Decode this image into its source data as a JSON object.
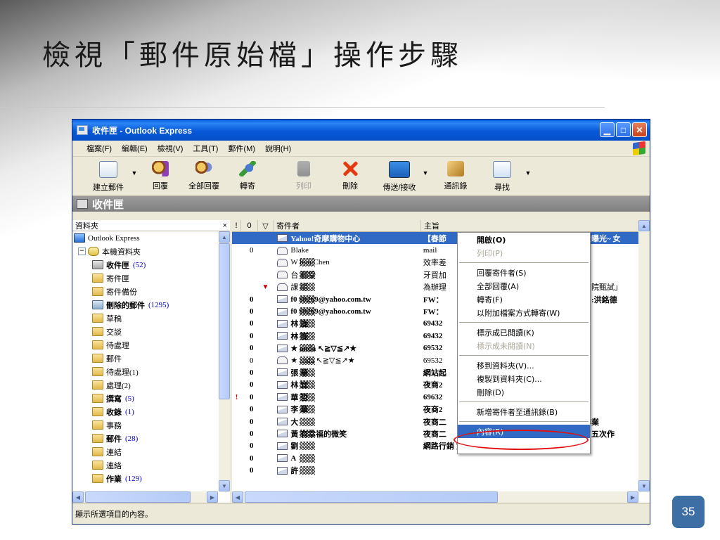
{
  "slide": {
    "title": "檢視「郵件原始檔」操作步驟",
    "page_number": "35"
  },
  "window": {
    "title": "收件匣 - Outlook Express",
    "menu": [
      "檔案(F)",
      "編輯(E)",
      "檢視(V)",
      "工具(T)",
      "郵件(M)",
      "說明(H)"
    ],
    "toolbar": [
      {
        "label": "建立郵件",
        "icon": "new-mail-icon",
        "enabled": true
      },
      {
        "label": "回覆",
        "icon": "reply-icon",
        "enabled": true
      },
      {
        "label": "全部回覆",
        "icon": "reply-all-icon",
        "enabled": true
      },
      {
        "label": "轉寄",
        "icon": "forward-icon",
        "enabled": true
      },
      {
        "label": "列印",
        "icon": "print-icon",
        "enabled": false
      },
      {
        "label": "刪除",
        "icon": "delete-icon",
        "enabled": true
      },
      {
        "label": "傳送/接收",
        "icon": "send-receive-icon",
        "enabled": true
      },
      {
        "label": "通訊錄",
        "icon": "address-book-icon",
        "enabled": true
      },
      {
        "label": "尋找",
        "icon": "find-icon",
        "enabled": true
      }
    ],
    "folder_bar_title": "收件匣",
    "folders_pane": {
      "header": "資料夾",
      "close_glyph": "×",
      "items": [
        {
          "label": "Outlook Express",
          "count": "",
          "bold": false
        },
        {
          "label": "本機資料夾",
          "count": "",
          "bold": false
        },
        {
          "label": "收件匣",
          "count": "(52)",
          "bold": true
        },
        {
          "label": "寄件匣",
          "count": "",
          "bold": false
        },
        {
          "label": "寄件備份",
          "count": "",
          "bold": false
        },
        {
          "label": "刪除的郵件",
          "count": "(1295)",
          "bold": true
        },
        {
          "label": "草稿",
          "count": "",
          "bold": false
        },
        {
          "label": "交談",
          "count": "",
          "bold": false
        },
        {
          "label": "待處理",
          "count": "",
          "bold": false
        },
        {
          "label": "郵件",
          "count": "",
          "bold": false
        },
        {
          "label": "待處理(1)",
          "count": "",
          "bold": false
        },
        {
          "label": "處理(2)",
          "count": "",
          "bold": false
        },
        {
          "label": "撰寫",
          "count": "(5)",
          "bold": true
        },
        {
          "label": "收錄",
          "count": "(1)",
          "bold": true
        },
        {
          "label": "事務",
          "count": "",
          "bold": false
        },
        {
          "label": "郵件",
          "count": "(28)",
          "bold": true
        },
        {
          "label": "連結",
          "count": "",
          "bold": false
        },
        {
          "label": "連絡",
          "count": "",
          "bold": false
        },
        {
          "label": "作業",
          "count": "(129)",
          "bold": true
        }
      ]
    },
    "message_list": {
      "columns": [
        "!",
        "0",
        "▽",
        "寄件者",
        "主旨"
      ],
      "rows": [
        {
          "from": "Yahoo!奇摩購物中心",
          "subject": "【春節",
          "subject_tail": "大曝光~ 女",
          "selected": true,
          "unread": true,
          "att": "",
          "pri": "",
          "flag": "",
          "env": "unread"
        },
        {
          "from": "Blake",
          "subject": "mail",
          "subject_tail": "",
          "selected": false,
          "unread": false,
          "att": "0",
          "pri": "",
          "flag": "",
          "env": "read"
        },
        {
          "from": "W   hou Chen",
          "subject": "效率差",
          "subject_tail": "",
          "selected": false,
          "unread": false,
          "att": "",
          "pri": "",
          "flag": "",
          "env": "read"
        },
        {
          "from": "台   郵受",
          "subject": "牙買加",
          "subject_tail": "",
          "selected": false,
          "unread": false,
          "att": "",
          "pri": "",
          "flag": "",
          "env": "read"
        },
        {
          "from": "課   組",
          "subject": "為辦理",
          "subject_tail": "校院甄試」",
          "selected": false,
          "unread": false,
          "att": "",
          "pri": "",
          "flag": "▼",
          "env": "read"
        },
        {
          "from": "f0   90269@yahoo.com.tw",
          "subject": "FW：",
          "subject_tail": "名:洪銘德",
          "selected": false,
          "unread": true,
          "att": "0",
          "pri": "",
          "flag": "",
          "env": "unread"
        },
        {
          "from": "f0   90269@yahoo.com.tw",
          "subject": "FW：",
          "subject_tail": "",
          "selected": false,
          "unread": true,
          "att": "0",
          "pri": "",
          "flag": "",
          "env": "unread"
        },
        {
          "from": "林   旋",
          "subject": "69432",
          "subject_tail": "",
          "selected": false,
          "unread": true,
          "att": "0",
          "pri": "",
          "flag": "",
          "env": "unread"
        },
        {
          "from": "林   旋",
          "subject": "69432",
          "subject_tail": "1",
          "selected": false,
          "unread": true,
          "att": "0",
          "pri": "",
          "flag": "",
          "env": "unread"
        },
        {
          "from": "★   anda ↖≧▽≦↗★",
          "subject": "69532",
          "subject_tail": "",
          "selected": false,
          "unread": true,
          "att": "0",
          "pri": "",
          "flag": "",
          "env": "unread"
        },
        {
          "from": "★   anda ↖≧▽≦↗★",
          "subject": "69532",
          "subject_tail": "",
          "selected": false,
          "unread": false,
          "att": "0",
          "pri": "",
          "flag": "",
          "env": "read"
        },
        {
          "from": "張   華",
          "subject": "網站起",
          "subject_tail": "",
          "selected": false,
          "unread": true,
          "att": "0",
          "pri": "",
          "flag": "",
          "env": "unread"
        },
        {
          "from": "林   宜",
          "subject": "夜商2",
          "subject_tail": "",
          "selected": false,
          "unread": true,
          "att": "0",
          "pri": "",
          "flag": "",
          "env": "unread"
        },
        {
          "from": "華   哲",
          "subject": "69632",
          "subject_tail": "",
          "selected": false,
          "unread": true,
          "att": "0",
          "pri": "!",
          "flag": "",
          "env": "unread"
        },
        {
          "from": "李   華",
          "subject": "夜商2",
          "subject_tail": "",
          "selected": false,
          "unread": true,
          "att": "0",
          "pri": "",
          "flag": "",
          "env": "unread"
        },
        {
          "from": "大   ",
          "subject": "夜商二",
          "subject_tail": "作業",
          "selected": false,
          "unread": true,
          "att": "0",
          "pri": "",
          "flag": "",
          "env": "unread"
        },
        {
          "from": "黃   有幸福的微笑",
          "subject": "夜商二",
          "subject_tail": "第五次作",
          "selected": false,
          "unread": true,
          "att": "0",
          "pri": "",
          "flag": "",
          "env": "unread"
        },
        {
          "from": "劉   ",
          "subject": "網路行銷 第五次作業",
          "subject_tail": "",
          "selected": false,
          "unread": true,
          "att": "0",
          "pri": "",
          "flag": "",
          "env": "unread"
        },
        {
          "from": "A   ",
          "subject": "",
          "subject_tail": "",
          "selected": false,
          "unread": true,
          "att": "0",
          "pri": "",
          "flag": "",
          "env": "unread"
        },
        {
          "from": "許   ",
          "subject": "",
          "subject_tail": "",
          "selected": false,
          "unread": true,
          "att": "0",
          "pri": "",
          "flag": "",
          "env": "unread"
        }
      ]
    },
    "context_menu": [
      {
        "label": "開啟(O)",
        "bold": true,
        "disabled": false,
        "highlighted": false
      },
      {
        "label": "列印(P)",
        "bold": false,
        "disabled": true,
        "highlighted": false
      },
      {
        "sep": true
      },
      {
        "label": "回覆寄件者(S)",
        "bold": false,
        "disabled": false,
        "highlighted": false
      },
      {
        "label": "全部回覆(A)",
        "bold": false,
        "disabled": false,
        "highlighted": false
      },
      {
        "label": "轉寄(F)",
        "bold": false,
        "disabled": false,
        "highlighted": false
      },
      {
        "label": "以附加檔案方式轉寄(W)",
        "bold": false,
        "disabled": false,
        "highlighted": false
      },
      {
        "sep": true
      },
      {
        "label": "標示成已閱讀(K)",
        "bold": false,
        "disabled": false,
        "highlighted": false
      },
      {
        "label": "標示成未閱讀(N)",
        "bold": false,
        "disabled": true,
        "highlighted": false
      },
      {
        "sep": true
      },
      {
        "label": "移到資料夾(V)...",
        "bold": false,
        "disabled": false,
        "highlighted": false
      },
      {
        "label": "複製到資料夾(C)...",
        "bold": false,
        "disabled": false,
        "highlighted": false
      },
      {
        "label": "刪除(D)",
        "bold": false,
        "disabled": false,
        "highlighted": false
      },
      {
        "sep": true
      },
      {
        "label": "新增寄件者至通訊錄(B)",
        "bold": false,
        "disabled": false,
        "highlighted": false
      },
      {
        "sep": true
      },
      {
        "label": "內容(R)",
        "bold": false,
        "disabled": false,
        "highlighted": true
      }
    ],
    "status_text": "顯示所選項目的內容。"
  }
}
